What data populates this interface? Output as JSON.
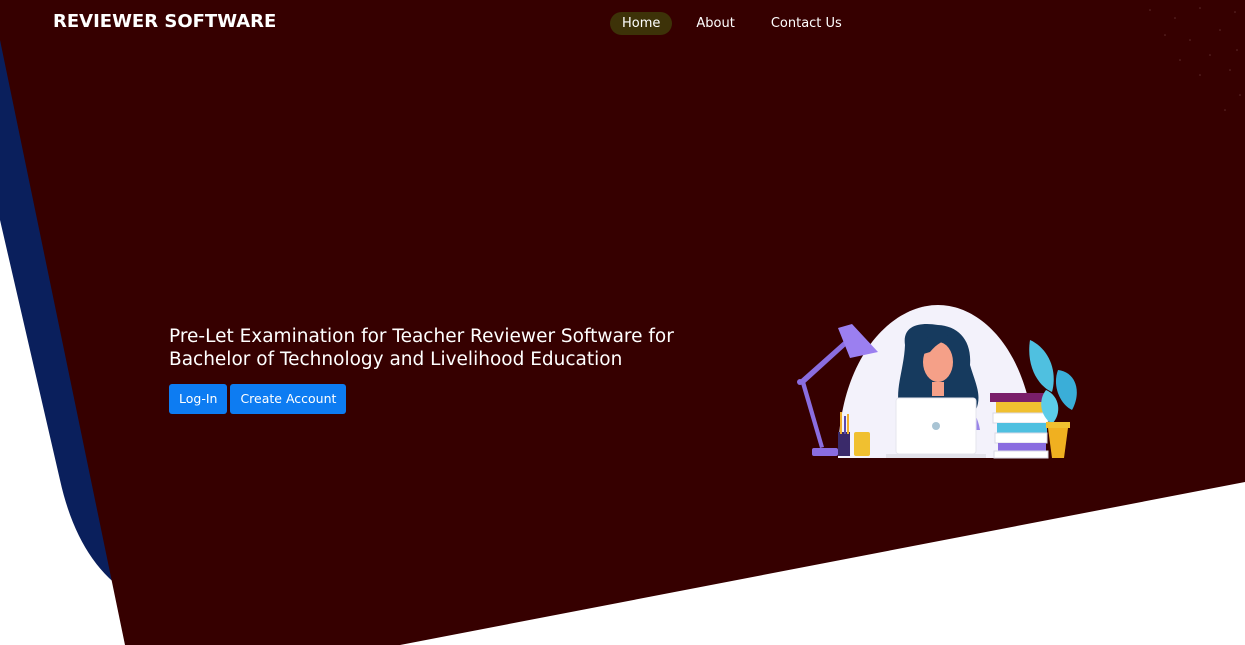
{
  "header": {
    "brand": "REVIEWER SOFTWARE",
    "nav": [
      {
        "label": "Home",
        "active": true
      },
      {
        "label": "About",
        "active": false
      },
      {
        "label": "Contact Us",
        "active": false
      }
    ]
  },
  "hero": {
    "heading_line1": "Pre-Let Examination for Teacher Reviewer Software for",
    "heading_line2": "Bachelor of Technology and Livelihood Education",
    "login_label": "Log-In",
    "create_account_label": "Create Account"
  },
  "colors": {
    "hero_background": "#360000",
    "accent_shape": "#0a1f5c",
    "active_nav": "#3d3208",
    "button": "#0d7cf2"
  },
  "icons": {
    "illustration": "woman-at-laptop-illustration"
  }
}
